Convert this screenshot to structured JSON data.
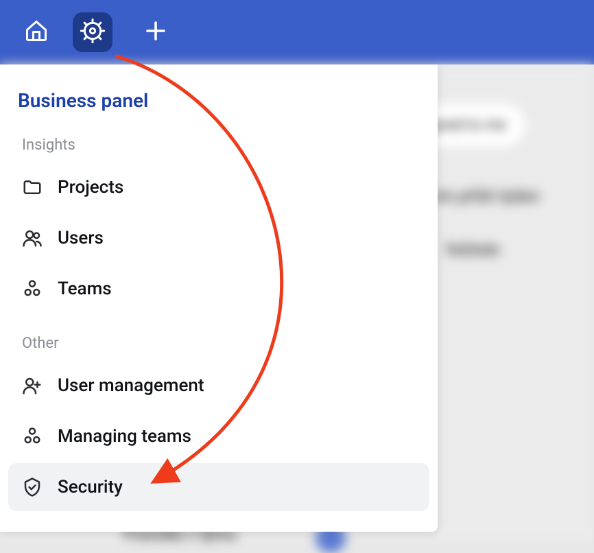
{
  "topbar": {
    "home_label": "Home",
    "settings_label": "Admin",
    "add_label": "Add"
  },
  "panel": {
    "title": "Business panel",
    "sections": [
      {
        "label": "Insights",
        "items": [
          {
            "icon": "folder",
            "label": "Projects"
          },
          {
            "icon": "users",
            "label": "Users"
          },
          {
            "icon": "teams",
            "label": "Teams"
          }
        ]
      },
      {
        "label": "Other",
        "items": [
          {
            "icon": "user-plus",
            "label": "User management"
          },
          {
            "icon": "teams",
            "label": "Managing teams"
          },
          {
            "icon": "shield",
            "label": "Security",
            "selected": true
          }
        ]
      }
    ]
  },
  "background": {
    "chip1": "gned to me",
    "text1": "nín příští týden",
    "text2": "fešitele",
    "text3": "Pravidla v týmu"
  },
  "annotation": {
    "arrow_from": "settings-button",
    "arrow_to": "sidebar-item-security",
    "color": "#ee3b1c"
  }
}
